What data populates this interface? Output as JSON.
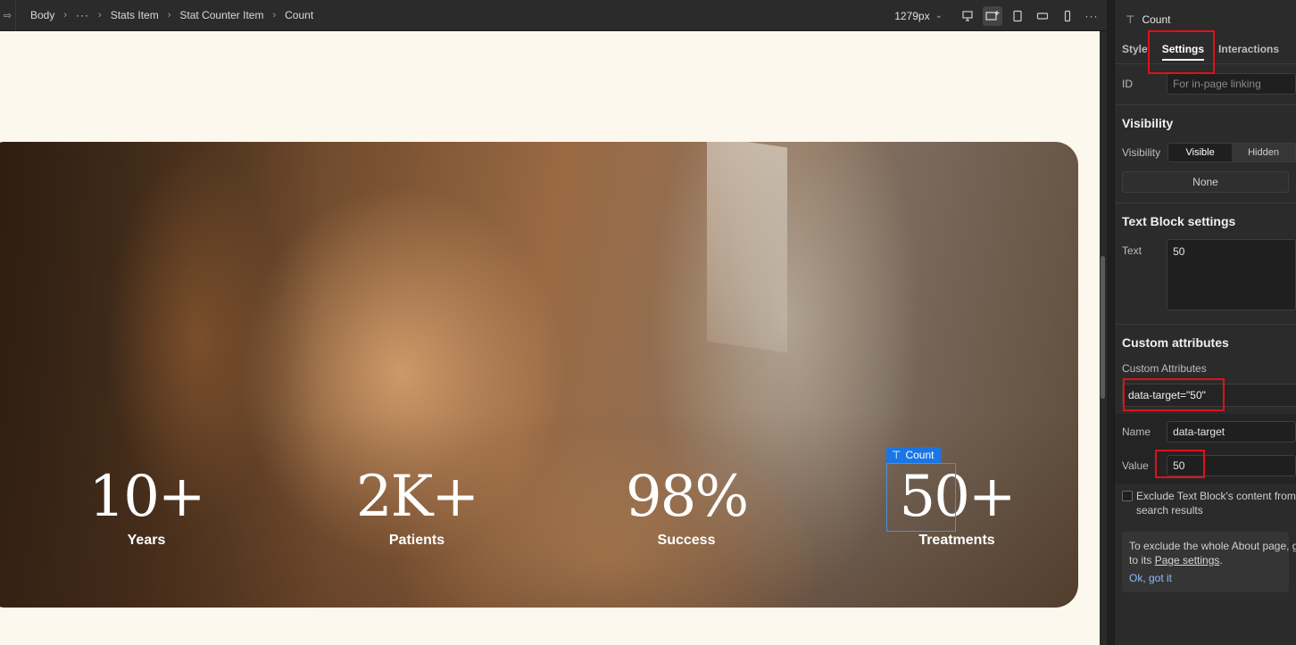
{
  "breadcrumb": {
    "items": [
      "Body",
      "···",
      "Stats Item",
      "Stat Counter Item",
      "Count"
    ]
  },
  "toolbar": {
    "width_readout": "1279px"
  },
  "canvas": {
    "stats": [
      {
        "number": "10+",
        "label": "Years"
      },
      {
        "number": "2K+",
        "label": "Patients"
      },
      {
        "number": "98%",
        "label": "Success"
      },
      {
        "number": "50+",
        "label": "Treatments"
      }
    ],
    "selection_tag": "Count"
  },
  "panel": {
    "element_name": "Count",
    "tabs": {
      "style": "Style",
      "settings": "Settings",
      "interactions": "Interactions"
    },
    "id_label": "ID",
    "id_placeholder": "For in-page linking",
    "visibility_title": "Visibility",
    "visibility_label": "Visibility",
    "visibility_options": {
      "visible": "Visible",
      "hidden": "Hidden"
    },
    "none_button": "None",
    "text_block_title": "Text Block settings",
    "text_label": "Text",
    "text_value": "50",
    "custom_attr_title": "Custom attributes",
    "custom_attr_label": "Custom Attributes",
    "attribute_chip": "data-target=\"50\"",
    "name_label": "Name",
    "name_value": "data-target",
    "value_label": "Value",
    "value_value": "50",
    "exclude_line1": "Exclude Text Block's content from",
    "exclude_line2": "search results",
    "info_line1": "To exclude the whole About page, g",
    "info_line2_prefix": "to its ",
    "info_link": "Page settings",
    "info_line2_suffix": ".",
    "info_ok": "Ok, got it"
  },
  "colors": {
    "accent_blue": "#1a76e6",
    "highlight_red": "#e0101a",
    "canvas_bg": "#fcf8ee",
    "panel_bg": "#2b2b2b"
  }
}
